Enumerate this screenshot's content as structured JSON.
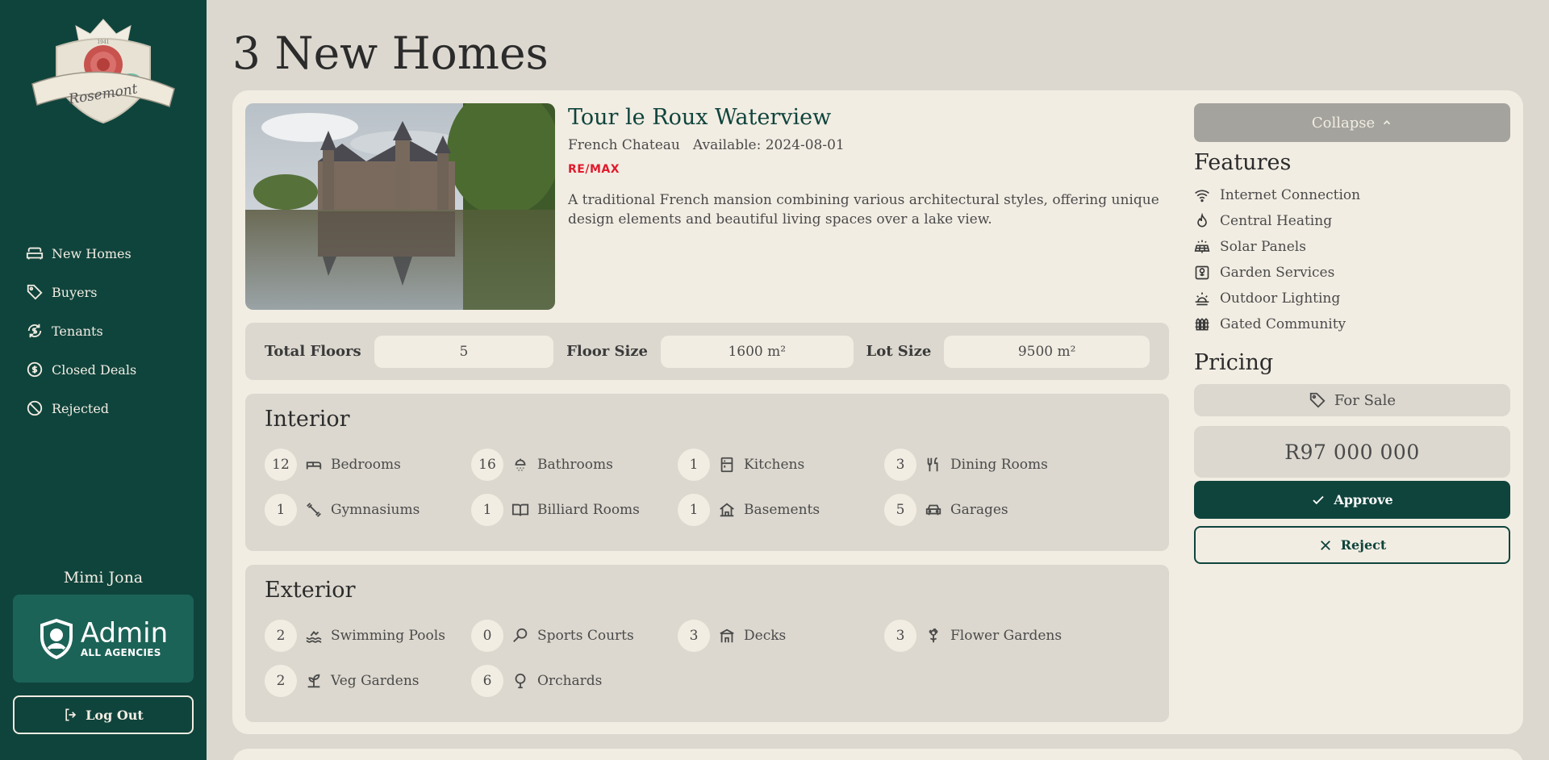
{
  "sidebar": {
    "logo_text": "Rosemont",
    "logo_year": "1941",
    "nav": [
      {
        "label": "New Homes",
        "icon": "sofa-icon"
      },
      {
        "label": "Buyers",
        "icon": "tag-icon"
      },
      {
        "label": "Tenants",
        "icon": "refresh-dollar-icon"
      },
      {
        "label": "Closed Deals",
        "icon": "dollar-circle-icon"
      },
      {
        "label": "Rejected",
        "icon": "ban-icon"
      }
    ],
    "user_name": "Mimi Jona",
    "admin_title": "Admin",
    "admin_subtitle": "ALL AGENCIES",
    "logout_label": "Log Out"
  },
  "page": {
    "title": "3 New Homes"
  },
  "listing": {
    "name": "Tour le Roux Waterview",
    "style": "French Chateau",
    "available": "Available: 2024-08-01",
    "agency_left": "RE/",
    "agency_right": "MAX",
    "description": "A traditional French mansion combining various architectural styles, offering unique design elements and beautiful living spaces over a lake view.",
    "stats": {
      "floors_label": "Total Floors",
      "floors_value": "5",
      "floor_size_label": "Floor Size",
      "floor_size_value": "1600 m²",
      "lot_size_label": "Lot Size",
      "lot_size_value": "9500 m²"
    },
    "interior": {
      "title": "Interior",
      "items": [
        {
          "count": "12",
          "label": "Bedrooms",
          "icon": "bed-icon"
        },
        {
          "count": "16",
          "label": "Bathrooms",
          "icon": "shower-icon"
        },
        {
          "count": "1",
          "label": "Kitchens",
          "icon": "fridge-icon"
        },
        {
          "count": "3",
          "label": "Dining Rooms",
          "icon": "utensils-icon"
        },
        {
          "count": "1",
          "label": "Gymnasiums",
          "icon": "dumbbell-icon"
        },
        {
          "count": "1",
          "label": "Billiard Rooms",
          "icon": "book-open-icon"
        },
        {
          "count": "1",
          "label": "Basements",
          "icon": "basement-icon"
        },
        {
          "count": "5",
          "label": "Garages",
          "icon": "car-icon"
        }
      ]
    },
    "exterior": {
      "title": "Exterior",
      "items": [
        {
          "count": "2",
          "label": "Swimming Pools",
          "icon": "swim-icon"
        },
        {
          "count": "0",
          "label": "Sports Courts",
          "icon": "racket-icon"
        },
        {
          "count": "3",
          "label": "Decks",
          "icon": "deck-icon"
        },
        {
          "count": "3",
          "label": "Flower Gardens",
          "icon": "flower-icon"
        },
        {
          "count": "2",
          "label": "Veg Gardens",
          "icon": "sprout-icon"
        },
        {
          "count": "6",
          "label": "Orchards",
          "icon": "tree-icon"
        }
      ]
    }
  },
  "right": {
    "collapse_label": "Collapse",
    "features_title": "Features",
    "features": [
      {
        "label": "Internet Connection",
        "icon": "wifi-icon"
      },
      {
        "label": "Central Heating",
        "icon": "flame-icon"
      },
      {
        "label": "Solar Panels",
        "icon": "solar-panel-icon"
      },
      {
        "label": "Garden Services",
        "icon": "garden-icon"
      },
      {
        "label": "Outdoor Lighting",
        "icon": "sunrise-icon"
      },
      {
        "label": "Gated Community",
        "icon": "fence-icon"
      }
    ],
    "pricing_title": "Pricing",
    "sale_type": "For Sale",
    "price": "R97 000 000",
    "approve_label": "Approve",
    "reject_label": "Reject"
  },
  "colors": {
    "sidebar": "#0f443c",
    "background": "#dcd8cf",
    "card": "#f2ede3",
    "accent": "#0f443c",
    "admin_card": "#1c6357"
  }
}
